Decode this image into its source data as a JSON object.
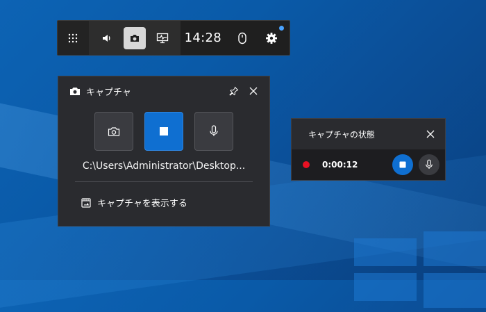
{
  "gamebar": {
    "time": "14:28",
    "icons": [
      "widget-menu-icon",
      "audio-icon",
      "capture-icon",
      "performance-icon",
      "mouse-icon",
      "settings-icon"
    ]
  },
  "capture_widget": {
    "title": "キャプチャ",
    "save_path": "C:\\Users\\Administrator\\Desktop...",
    "show_captures_label": "キャプチャを表示する"
  },
  "status_widget": {
    "title": "キャプチャの状態",
    "elapsed": "0:00:12"
  },
  "colors": {
    "accent": "#0f6fd1",
    "recording": "#e81123",
    "panel": "#2a2b2f"
  }
}
